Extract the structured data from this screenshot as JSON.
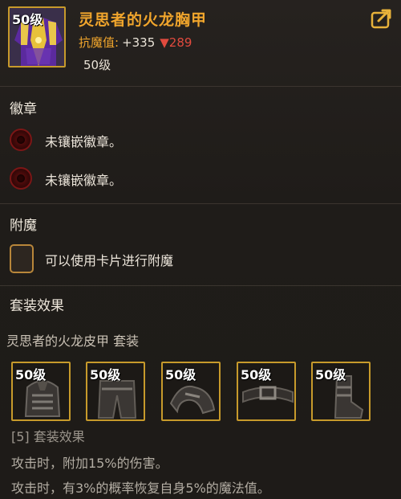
{
  "item": {
    "level_badge": "50级",
    "name": "灵思者的火龙胸甲",
    "stat_label": "抗魔值:",
    "stat_value": "+335",
    "stat_diff": "▼289",
    "level_text": "50级",
    "share_icon": "share-icon"
  },
  "badges": {
    "title": "徽章",
    "slots": [
      {
        "text": "未镶嵌徽章。"
      },
      {
        "text": "未镶嵌徽章。"
      }
    ]
  },
  "enchant": {
    "title": "附魔",
    "text": "可以使用卡片进行附魔"
  },
  "set": {
    "title": "套装效果",
    "name": "灵思者的火龙皮甲  套装",
    "items": [
      {
        "level": "50级",
        "icon": "helmet-icon"
      },
      {
        "level": "50级",
        "icon": "pants-icon"
      },
      {
        "level": "50级",
        "icon": "shoulder-icon"
      },
      {
        "level": "50级",
        "icon": "belt-icon"
      },
      {
        "level": "50级",
        "icon": "boots-icon"
      }
    ],
    "effect_header": "[5] 套装效果",
    "effects": [
      "攻击时，附加15%的伤害。",
      "攻击时，有3%的概率恢复自身5%的魔法值。"
    ]
  },
  "colors": {
    "title_orange": "#f0a52c",
    "border_gold": "#c79a2b",
    "stat_down_red": "#e14a3e"
  }
}
